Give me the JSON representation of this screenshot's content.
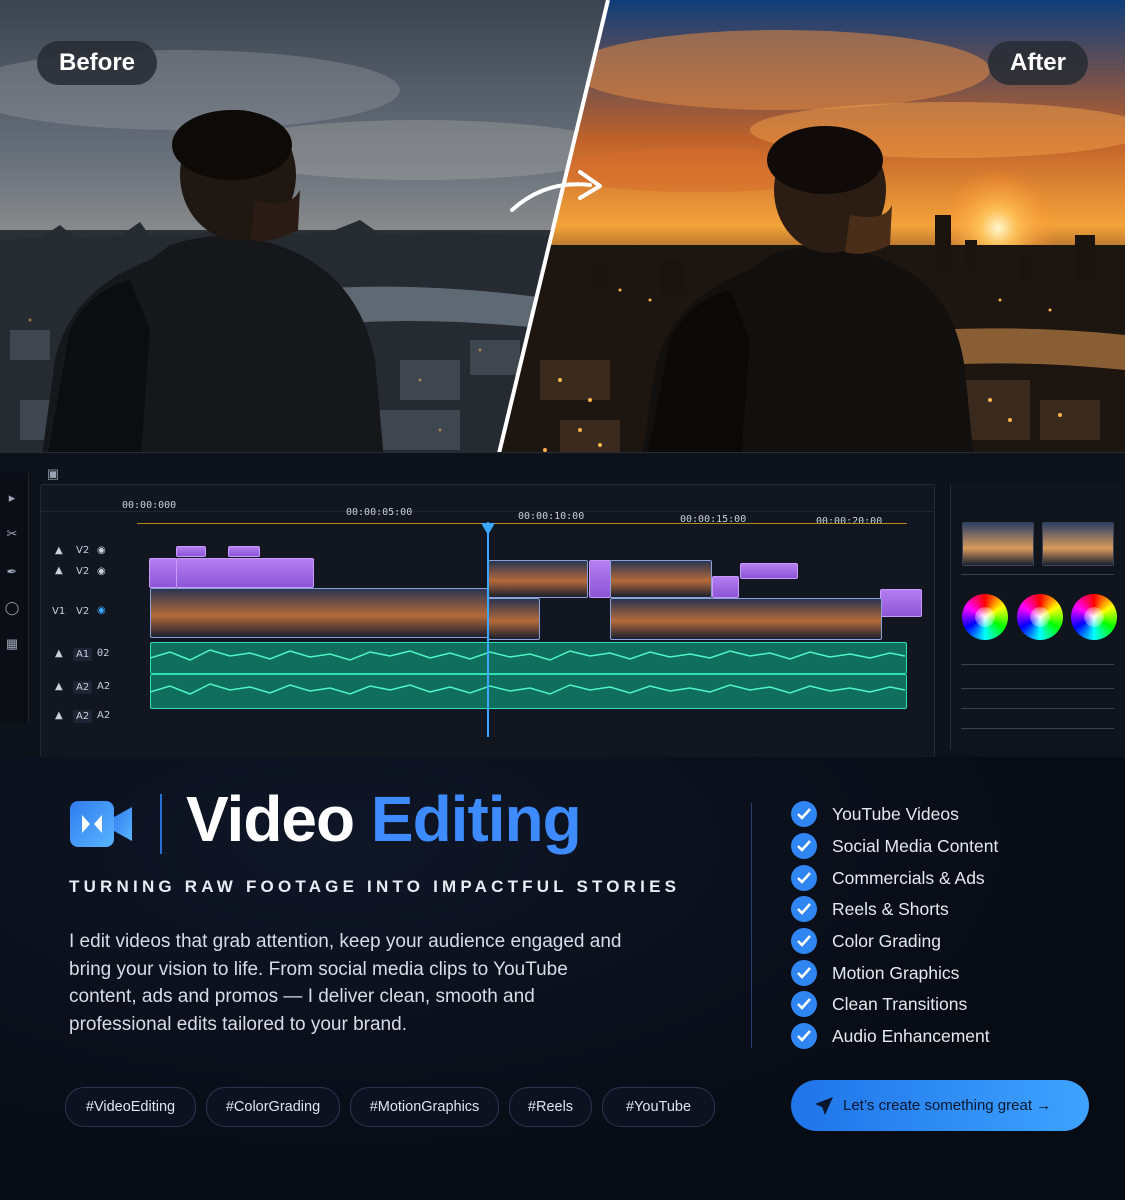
{
  "hero": {
    "before_label": "Before",
    "after_label": "After"
  },
  "editor": {
    "timecodes": [
      "00:00:000",
      "00:00:05:00",
      "00:00:10:00",
      "00:00:15:00",
      "00:00:20:00"
    ],
    "tracks": [
      {
        "label": "V2"
      },
      {
        "label": "V2"
      },
      {
        "label": "V1",
        "label2": "V2"
      },
      {
        "label": "A1",
        "label2": "θ2"
      },
      {
        "label": "A2",
        "label2": "A2"
      },
      {
        "label": "A2",
        "label2": "A2"
      }
    ]
  },
  "service": {
    "title_part1": "Video",
    "title_part2": "Editing",
    "tagline": "TURNING RAW FOOTAGE INTO IMPACTFUL STORIES",
    "description": "I edit videos that grab attention, keep your audience engaged and bring your vision to life. From social media clips to YouTube content, ads and promos — I deliver clean, smooth and professional edits tailored to your brand."
  },
  "features": [
    "YouTube Videos",
    "Social Media Content",
    "Commercials & Ads",
    "Reels & Shorts",
    "Color Grading",
    "Motion Graphics",
    "Clean Transitions",
    "Audio Enhancement"
  ],
  "tags": [
    "#VideoEditing",
    "#ColorGrading",
    "#MotionGraphics",
    "#Reels",
    "#YouTube"
  ],
  "cta": {
    "label": "Let’s create something great →"
  },
  "colors": {
    "accent": "#3d8bff",
    "background": "#070b14"
  }
}
